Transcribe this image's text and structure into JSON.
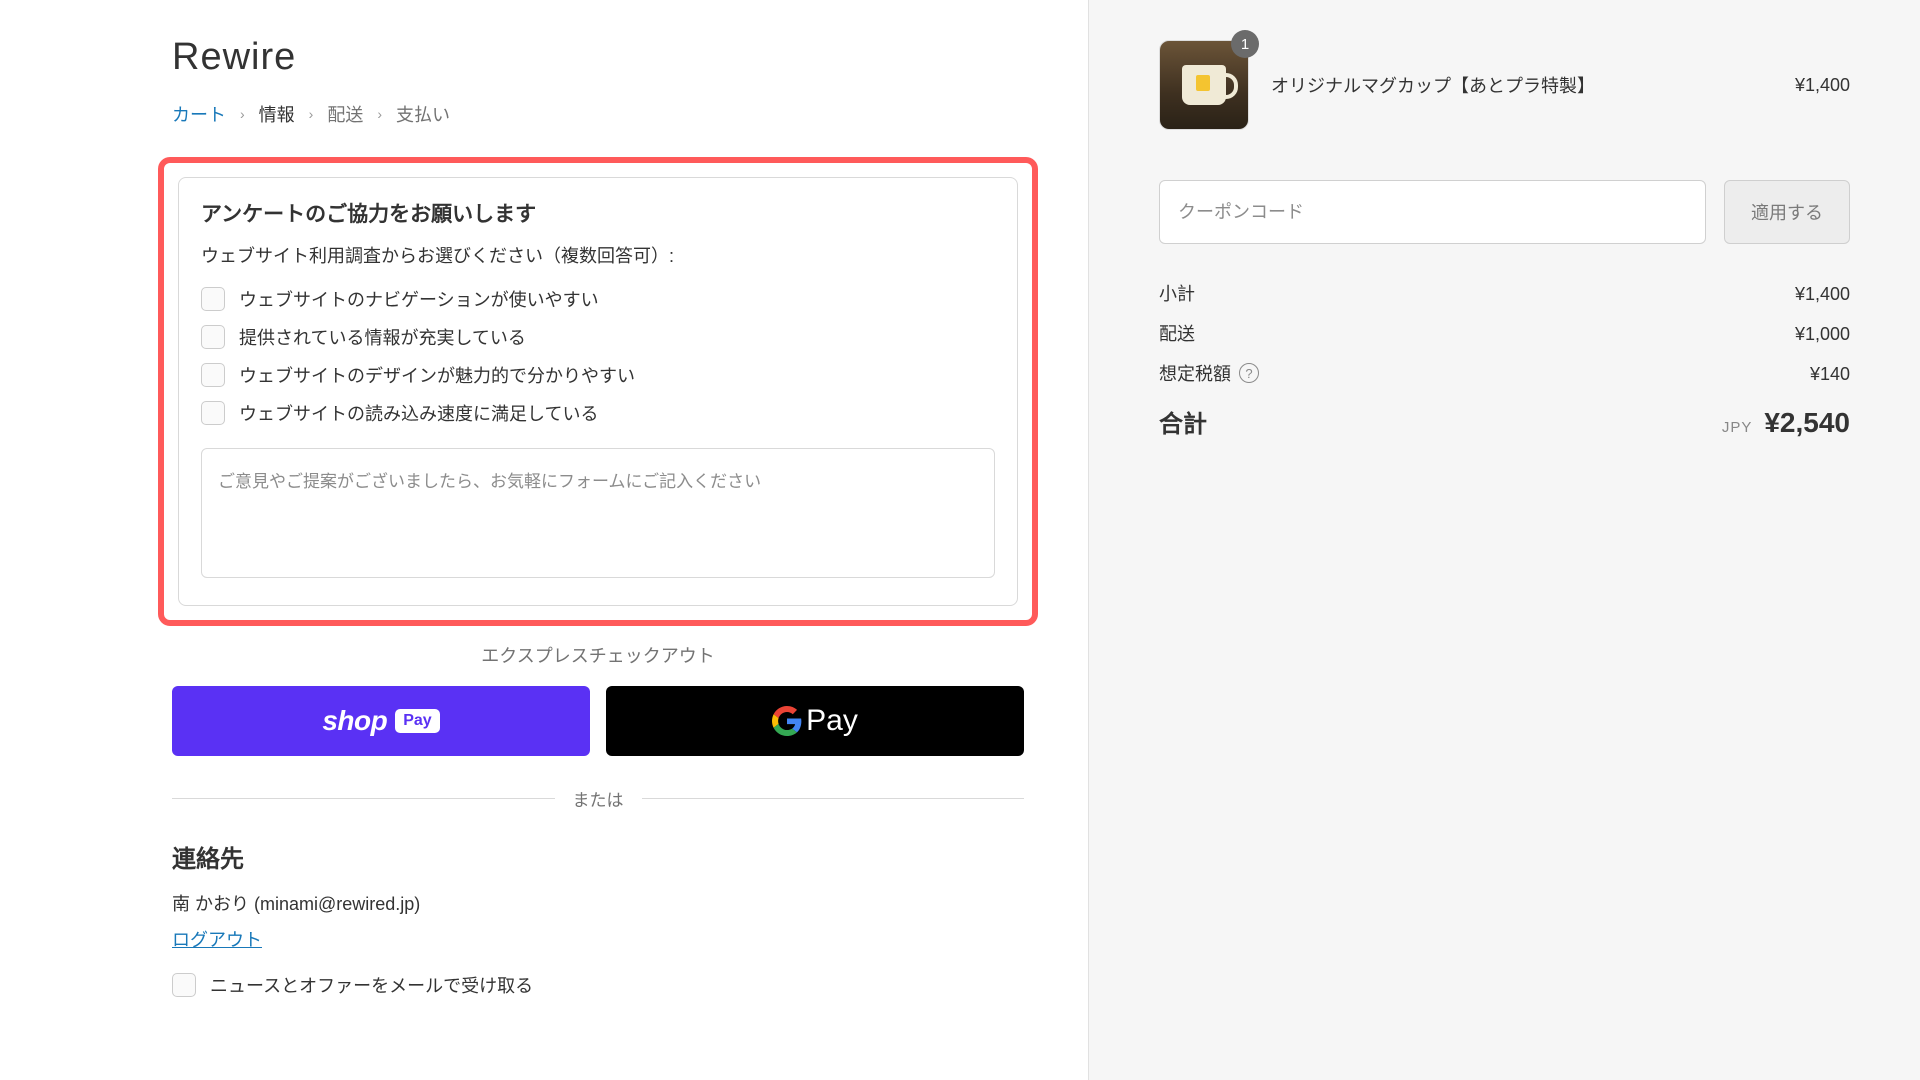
{
  "store": {
    "name": "Rewire"
  },
  "breadcrumb": {
    "items": [
      {
        "label": "カート",
        "active": true
      },
      {
        "label": "情報"
      },
      {
        "label": "配送"
      },
      {
        "label": "支払い"
      }
    ]
  },
  "survey": {
    "title": "アンケートのご協力をお願いします",
    "subtitle": "ウェブサイト利用調査からお選びください（複数回答可）:",
    "options": [
      "ウェブサイトのナビゲーションが使いやすい",
      "提供されている情報が充実している",
      "ウェブサイトのデザインが魅力的で分かりやすい",
      "ウェブサイトの読み込み速度に満足している"
    ],
    "feedback_placeholder": "ご意見やご提案がございましたら、お気軽にフォームにご記入ください"
  },
  "express": {
    "label": "エクスプレスチェックアウト",
    "shoppay_text": "shop",
    "shoppay_badge": "Pay",
    "gpay_text": "Pay",
    "divider": "または"
  },
  "contact": {
    "heading": "連絡先",
    "name_line": "南 かおり (minami@rewired.jp)",
    "logout": "ログアウト",
    "newsletter": "ニュースとオファーをメールで受け取る"
  },
  "cart": {
    "items": [
      {
        "name": "オリジナルマグカップ【あとプラ特製】",
        "qty": "1",
        "price": "¥1,400"
      }
    ]
  },
  "coupon": {
    "placeholder": "クーポンコード",
    "apply": "適用する"
  },
  "summary": {
    "subtotal_label": "小計",
    "subtotal_value": "¥1,400",
    "shipping_label": "配送",
    "shipping_value": "¥1,000",
    "tax_label": "想定税額",
    "tax_value": "¥140",
    "total_label": "合計",
    "currency": "JPY",
    "total_value": "¥2,540"
  }
}
